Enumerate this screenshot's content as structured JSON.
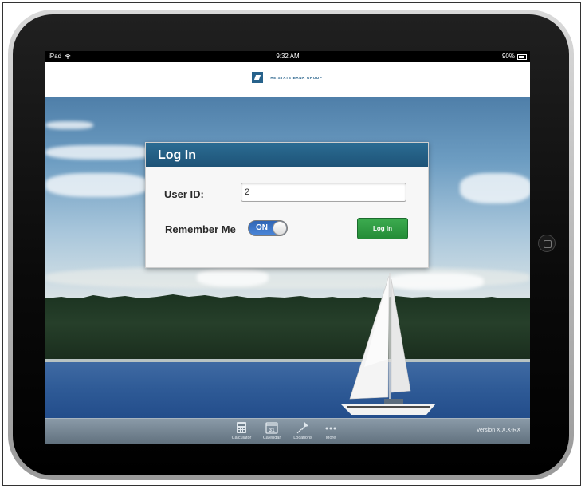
{
  "statusbar": {
    "device": "iPad",
    "time": "9:32 AM",
    "battery": "90%"
  },
  "header": {
    "logo_text": "THE STATE BANK GROUP"
  },
  "dialog": {
    "title": "Log In",
    "user_id_label": "User ID:",
    "user_id_value": "2",
    "remember_label": "Remember Me",
    "toggle_state": "ON",
    "login_button": "Log In"
  },
  "toolbar": {
    "items": [
      {
        "label": "Calculator",
        "icon": "calculator-icon"
      },
      {
        "label": "Calendar",
        "icon": "calendar-icon",
        "icon_text": "31"
      },
      {
        "label": "Locations",
        "icon": "pin-icon"
      },
      {
        "label": "More",
        "icon": "more-icon"
      }
    ],
    "version": "Version X.X.X-RX"
  },
  "colors": {
    "header_blue": "#1e5377",
    "login_green": "#248c37",
    "toggle_blue": "#2f65b5"
  }
}
